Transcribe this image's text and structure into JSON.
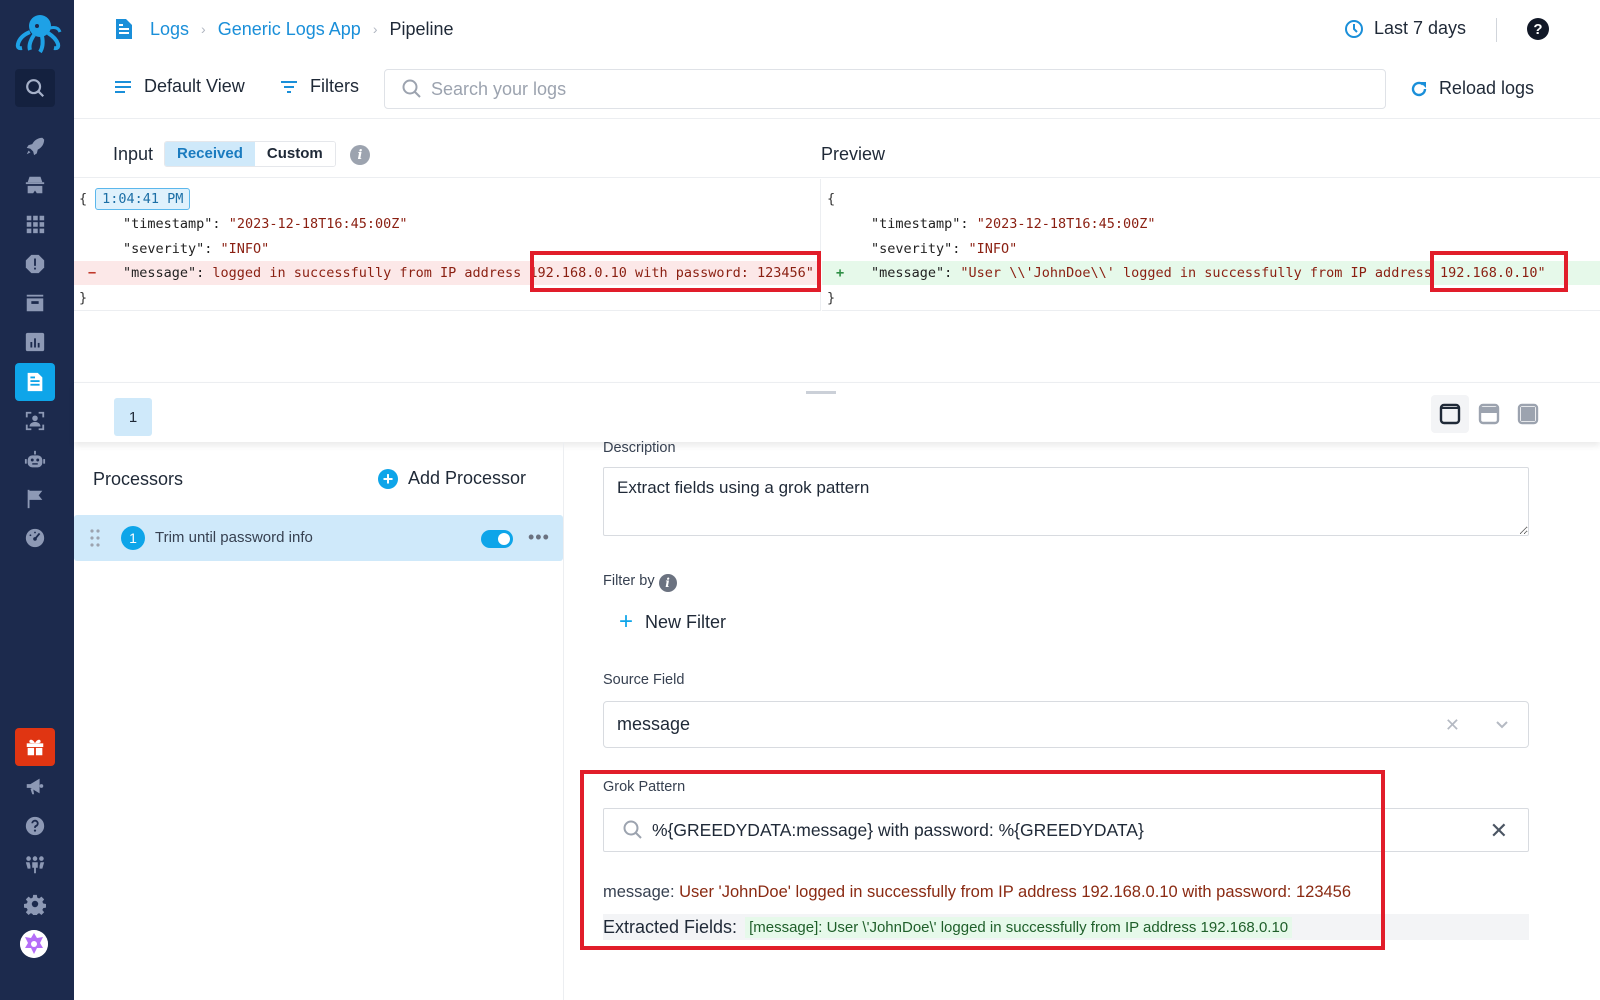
{
  "sidebar": {
    "items": [
      {
        "name": "search",
        "icon": "search-icon"
      },
      {
        "name": "getting-started",
        "icon": "rocket-icon"
      },
      {
        "name": "security",
        "icon": "spy-icon"
      },
      {
        "name": "apps",
        "icon": "grid-icon"
      },
      {
        "name": "alerts",
        "icon": "alert-octagon-icon"
      },
      {
        "name": "archive",
        "icon": "archive-box-icon"
      },
      {
        "name": "dashboards",
        "icon": "bar-chart-icon"
      },
      {
        "name": "logs",
        "icon": "document-icon",
        "active": true
      },
      {
        "name": "user-tracking",
        "icon": "face-scan-icon"
      },
      {
        "name": "bots",
        "icon": "robot-icon"
      },
      {
        "name": "flags",
        "icon": "flag-icon"
      },
      {
        "name": "performance",
        "icon": "gauge-icon"
      },
      {
        "name": "whats-new",
        "icon": "gift-icon"
      },
      {
        "name": "announcements",
        "icon": "megaphone-icon"
      },
      {
        "name": "help",
        "icon": "question-circle-icon"
      },
      {
        "name": "team",
        "icon": "users-icon"
      },
      {
        "name": "settings",
        "icon": "gear-icon"
      }
    ],
    "accent": "#0ea5e9",
    "gift_color": "#e03512"
  },
  "header": {
    "breadcrumb": [
      "Logs",
      "Generic Logs App",
      "Pipeline"
    ],
    "time_range": "Last 7 days",
    "help": "?"
  },
  "toolbar": {
    "default_view": "Default View",
    "filters": "Filters",
    "search_placeholder": "Search your logs",
    "search_value": "",
    "reload": "Reload logs"
  },
  "input_panel": {
    "label": "Input",
    "modes": [
      "Received",
      "Custom"
    ],
    "selected_mode": "Received",
    "timestamp_chip": "1:04:41 PM",
    "open_brace": "{",
    "close_brace": "}",
    "lines": [
      {
        "key": "\"timestamp\":",
        "value": "\"2023-12-18T16:45:00Z\""
      },
      {
        "key": "\"severity\":",
        "value": "\"INFO\""
      },
      {
        "marker": "−",
        "key": "\"message\":",
        "value": " logged in successfully from IP address 192.168.0.10 with password: 123456\""
      }
    ]
  },
  "preview_panel": {
    "label": "Preview",
    "open_brace": "{",
    "close_brace": "}",
    "lines": [
      {
        "key": "\"timestamp\":",
        "value": "\"2023-12-18T16:45:00Z\""
      },
      {
        "key": "\"severity\":",
        "value": "\"INFO\""
      },
      {
        "marker": "+",
        "key": "\"message\":",
        "value": "\"User \\\\'JohnDoe\\\\' logged in successfully from IP address 192.168.0.10\""
      }
    ]
  },
  "pager": {
    "current_page": "1"
  },
  "processors": {
    "title": "Processors",
    "add_label": "Add Processor",
    "items": [
      {
        "index": "1",
        "name": "Trim until password info",
        "enabled": true
      }
    ]
  },
  "form": {
    "description_label": "Description",
    "description_value": "Extract fields using a grok pattern",
    "filter_label": "Filter by",
    "new_filter": "New Filter",
    "source_field_label": "Source Field",
    "source_field_value": "message",
    "grok_label": "Grok Pattern",
    "grok_value": "%{GREEDYDATA:message} with password: %{GREEDYDATA}",
    "message_key": "message:",
    "message_value": "User 'JohnDoe' logged in successfully from IP address 192.168.0.10 with password: 123456",
    "extracted_label": "Extracted Fields:",
    "extracted_value": "[message]: User \\'JohnDoe\\' logged in successfully from IP address 192.168.0.10"
  }
}
